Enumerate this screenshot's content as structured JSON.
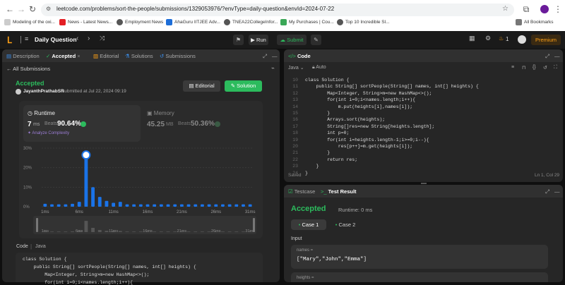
{
  "browser": {
    "url": "leetcode.com/problems/sort-the-people/submissions/1329053976/?envType=daily-question&envId=2024-07-22",
    "bookmarks": [
      {
        "label": "Modeling of the oxi...",
        "color": "#ddd"
      },
      {
        "label": "News - Latest News...",
        "color": "#e31e24"
      },
      {
        "label": "Employment News",
        "color": "#555"
      },
      {
        "label": "AhaGuru IITJEE Adv...",
        "color": "#1d6ed8"
      },
      {
        "label": "TNEA22CollegeInfor...",
        "color": "#555"
      },
      {
        "label": "My Purchases | Cou...",
        "color": "#3aa757"
      },
      {
        "label": "Top 10 Incredible Sl...",
        "color": "#555"
      }
    ],
    "all_bookmarks": "All Bookmarks"
  },
  "header": {
    "title": "Daily Question",
    "run": "Run",
    "submit": "Submit",
    "streak": "1",
    "premium": "Premium"
  },
  "left": {
    "tabs": [
      "Description",
      "Accepted",
      "Editorial",
      "Solutions",
      "Submissions"
    ],
    "back": "All Submissions",
    "status": "Accepted",
    "user": "JayanthPrathabSR",
    "submitted": "submitted at Jul 22, 2024 09:19",
    "editorial_btn": "Editorial",
    "solution_btn": "Solution",
    "runtime_label": "Runtime",
    "runtime_value": "7",
    "runtime_unit": "ms",
    "beats": "Beats",
    "runtime_beats": "90.64%",
    "analyze": "Analyze Complexity",
    "memory_label": "Memory",
    "memory_value": "45.25",
    "memory_unit": "MB",
    "memory_beats": "50.36%",
    "code_header": "Code",
    "code_lang": "Java"
  },
  "chart_data": {
    "type": "bar",
    "ylim": [
      0,
      30
    ],
    "yticks": [
      "30%",
      "20%",
      "10%",
      "0%"
    ],
    "xticks": [
      "1ms",
      "6ms",
      "11ms",
      "16ms",
      "21ms",
      "26ms",
      "31ms"
    ],
    "rangeticks": [
      "1ms",
      "6ms",
      "11ms",
      "16ms",
      "21ms",
      "26ms",
      "31ms"
    ],
    "x": [
      1,
      2,
      3,
      4,
      5,
      6,
      7,
      8,
      9,
      10,
      11,
      12,
      13,
      14,
      15,
      16,
      17,
      18,
      19,
      20,
      21,
      22,
      23,
      24,
      25,
      26,
      27,
      28,
      29,
      30,
      31
    ],
    "values": [
      1.5,
      1.2,
      1.2,
      1.2,
      1.5,
      2.5,
      26.5,
      10,
      5,
      3,
      2,
      2.5,
      1.2,
      1.2,
      1.2,
      1.2,
      1.2,
      1.2,
      1.2,
      1.2,
      1.2,
      1.2,
      1.2,
      1.2,
      1.2,
      1.2,
      1.2,
      1.2,
      1.2,
      1.2,
      1.2
    ],
    "highlight_x": 7
  },
  "editor": {
    "title": "Code",
    "lang": "Java",
    "mode": "Auto",
    "saved": "Saved",
    "cursor": "Ln 1, Col 29",
    "line_numbers": [
      "10",
      "11",
      "12",
      "13",
      "14",
      "15",
      "16",
      "17",
      "18",
      "19",
      "20",
      "21",
      "22",
      "23",
      "24"
    ],
    "lines": [
      "class Solution {",
      "    public String[] sortPeople(String[] names, int[] heights) {",
      "        Map<Integer, String>m=new HashMap<>();",
      "        for(int i=0;i<names.length;i++){",
      "            m.put(heights[i],names[i]);",
      "        }",
      "        Arrays.sort(heights);",
      "        String[]res=new String[heights.length];",
      "        int p=0;",
      "        for(int i=heights.length-1;i>=0;i--){",
      "            res[p++]=m.get(heights[i]);",
      "        }",
      "        return res;",
      "    }",
      "}"
    ]
  },
  "result": {
    "tabs": [
      "Testcase",
      "Test Result"
    ],
    "status": "Accepted",
    "runtime": "Runtime: 0 ms",
    "cases": [
      "Case 1",
      "Case 2"
    ],
    "input_label": "Input",
    "names_label": "names =",
    "names_value": "[\"Mary\",\"John\",\"Emma\"]",
    "heights_label": "heights ="
  },
  "snippet": [
    "class Solution {",
    "    public String[] sortPeople(String[] names, int[] heights) {",
    "        Map<Integer, String>m=new HashMap<>();",
    "        for(int i=0;i<names.length;i++){"
  ]
}
